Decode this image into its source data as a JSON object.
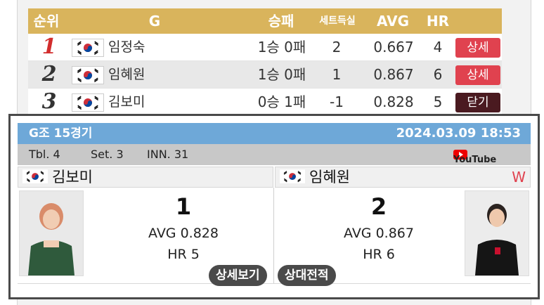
{
  "standings": {
    "headers": {
      "rank": "순위",
      "group": "G",
      "win_loss": "승패",
      "set_diff": "세트득실",
      "avg": "AVG",
      "hr": "HR"
    },
    "rows": [
      {
        "rank": "1",
        "name": "임정숙",
        "win_loss": "1승 0패",
        "set_diff": "2",
        "avg": "0.667",
        "hr": "4",
        "action": "상세"
      },
      {
        "rank": "2",
        "name": "임혜원",
        "win_loss": "1승 0패",
        "set_diff": "1",
        "avg": "0.867",
        "hr": "6",
        "action": "상세"
      },
      {
        "rank": "3",
        "name": "김보미",
        "win_loss": "0승 1패",
        "set_diff": "-1",
        "avg": "0.828",
        "hr": "5",
        "action": "닫기"
      }
    ]
  },
  "match": {
    "group_game": "G조 15경기",
    "datetime": "2024.03.09 18:53",
    "table": "Tbl. 4",
    "set": "Set. 3",
    "inning": "INN. 31",
    "youtube_label": "YouTube",
    "left_player": {
      "name": "김보미",
      "score": "1",
      "avg": "AVG 0.828",
      "hr": "HR 5"
    },
    "right_player": {
      "name": "임혜원",
      "score": "2",
      "avg": "AVG 0.867",
      "hr": "HR 6",
      "result": "W"
    },
    "buttons": {
      "detail": "상세보기",
      "head_to_head": "상대전적"
    }
  },
  "colors": {
    "header_gold": "#d9b45c",
    "card_blue": "#6ea8d8",
    "detail_red": "#e0424f",
    "close_dark": "#4a1a20",
    "rank_first": "#d22d2d"
  },
  "icons": {
    "flag": "korea-flag-icon",
    "youtube": "youtube-icon"
  }
}
